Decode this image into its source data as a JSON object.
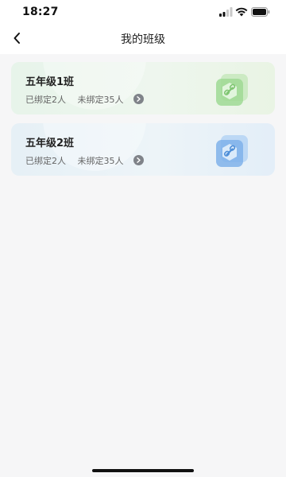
{
  "status_bar": {
    "time": "18:27"
  },
  "nav": {
    "title": "我的班级"
  },
  "classes": [
    {
      "name": "五年级1班",
      "bound": "已绑定2人",
      "unbound": "未绑定35人",
      "theme": "#8fd18a"
    },
    {
      "name": "五年级2班",
      "bound": "已绑定2人",
      "unbound": "未绑定35人",
      "theme": "#6fa8e6"
    }
  ],
  "colors": {
    "page_bg": "#f6f6f7",
    "green_card": "#e9f4e8",
    "blue_card": "#e7f1f7",
    "arrow_button": "#7f8389"
  },
  "icons": {
    "back": "back-chevron-icon",
    "badge": "link-icon"
  }
}
